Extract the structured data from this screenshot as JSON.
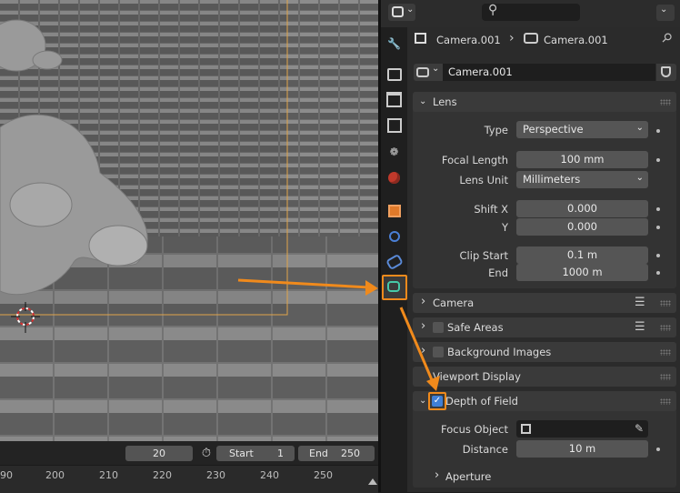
{
  "header": {
    "search_placeholder": ""
  },
  "breadcrumb": {
    "object": "Camera.001",
    "data": "Camera.001"
  },
  "datablock": {
    "name": "Camera.001"
  },
  "lens": {
    "title": "Lens",
    "type_label": "Type",
    "type_value": "Perspective",
    "focal_label": "Focal Length",
    "focal_value": "100 mm",
    "unit_label": "Lens Unit",
    "unit_value": "Millimeters",
    "shiftx_label": "Shift X",
    "shiftx_value": "0.000",
    "shifty_label": "Y",
    "shifty_value": "0.000",
    "clipstart_label": "Clip Start",
    "clipstart_value": "0.1 m",
    "clipend_label": "End",
    "clipend_value": "1000 m"
  },
  "panels": {
    "camera": "Camera",
    "safe_areas": "Safe Areas",
    "background_images": "Background Images",
    "viewport_display": "Viewport Display",
    "dof": "Depth of Field"
  },
  "dof": {
    "focus_object_label": "Focus Object",
    "distance_label": "Distance",
    "distance_value": "10 m",
    "aperture": "Aperture"
  },
  "timeline": {
    "current_frame": "20",
    "start_label": "Start",
    "start_value": "1",
    "end_label": "End",
    "end_value": "250",
    "ticks": [
      "90",
      "200",
      "210",
      "220",
      "230",
      "240",
      "250"
    ]
  },
  "colors": {
    "accent": "#f08a1c",
    "checkbox": "#3f7fd6"
  }
}
